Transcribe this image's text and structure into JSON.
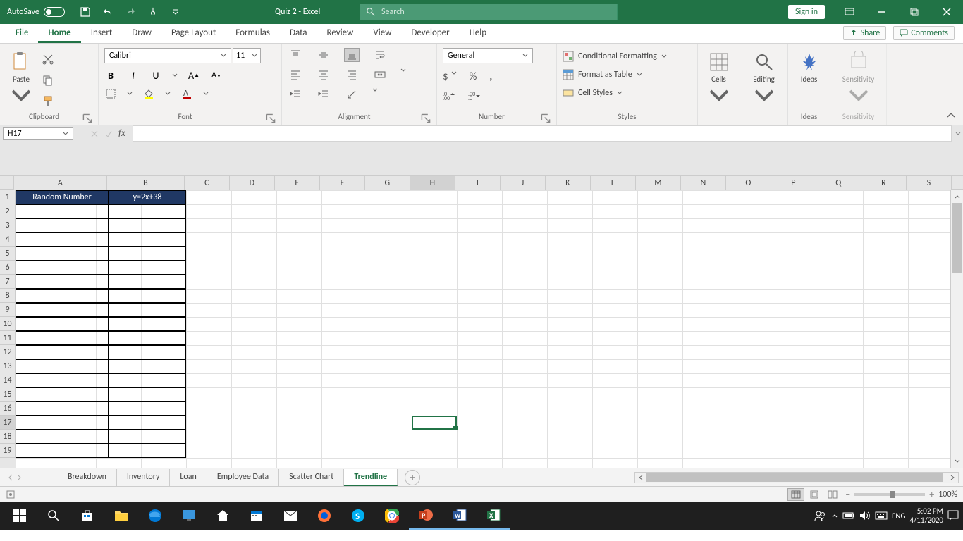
{
  "titlebar": {
    "autosave_label": "AutoSave",
    "autosave_state": "Off",
    "app_title": "Quiz 2  -  Excel",
    "search_placeholder": "Search",
    "signin_label": "Sign in"
  },
  "tabs": {
    "items": [
      "File",
      "Home",
      "Insert",
      "Draw",
      "Page Layout",
      "Formulas",
      "Data",
      "Review",
      "View",
      "Developer",
      "Help"
    ],
    "active": "Home",
    "share_label": "Share",
    "comments_label": "Comments"
  },
  "ribbon": {
    "clipboard": {
      "label": "Clipboard",
      "paste": "Paste"
    },
    "font": {
      "label": "Font",
      "name": "Calibri",
      "size": "11"
    },
    "alignment": {
      "label": "Alignment"
    },
    "number": {
      "label": "Number",
      "format": "General"
    },
    "styles": {
      "label": "Styles",
      "conditional": "Conditional Formatting",
      "table": "Format as Table",
      "cell": "Cell Styles"
    },
    "cells": {
      "label": "Cells"
    },
    "editing": {
      "label": "Editing"
    },
    "ideas": {
      "label": "Ideas"
    },
    "sensitivity": {
      "label": "Sensitivity"
    }
  },
  "formula_bar": {
    "cell_ref": "H17",
    "formula": ""
  },
  "grid": {
    "columns": [
      "A",
      "B",
      "C",
      "D",
      "E",
      "F",
      "G",
      "H",
      "I",
      "J",
      "K",
      "L",
      "M",
      "N",
      "O",
      "P",
      "Q",
      "R",
      "S"
    ],
    "col_widths": {
      "A": 132,
      "B": 110,
      "default": 64
    },
    "row_count": 19,
    "selected_col": "H",
    "selected_row": 17,
    "headers": {
      "A1": "Random Number",
      "B1": "y=2x+38"
    },
    "bordered_range_rows": 19,
    "bordered_range_cols": [
      "A",
      "B"
    ]
  },
  "sheets": {
    "tabs": [
      "Breakdown",
      "Inventory",
      "Loan",
      "Employee Data",
      "Scatter Chart",
      "Trendline"
    ],
    "active": "Trendline"
  },
  "statusbar": {
    "zoom": "100%"
  },
  "taskbar": {
    "lang": "ENG",
    "time": "5:02 PM",
    "date": "4/11/2020"
  }
}
